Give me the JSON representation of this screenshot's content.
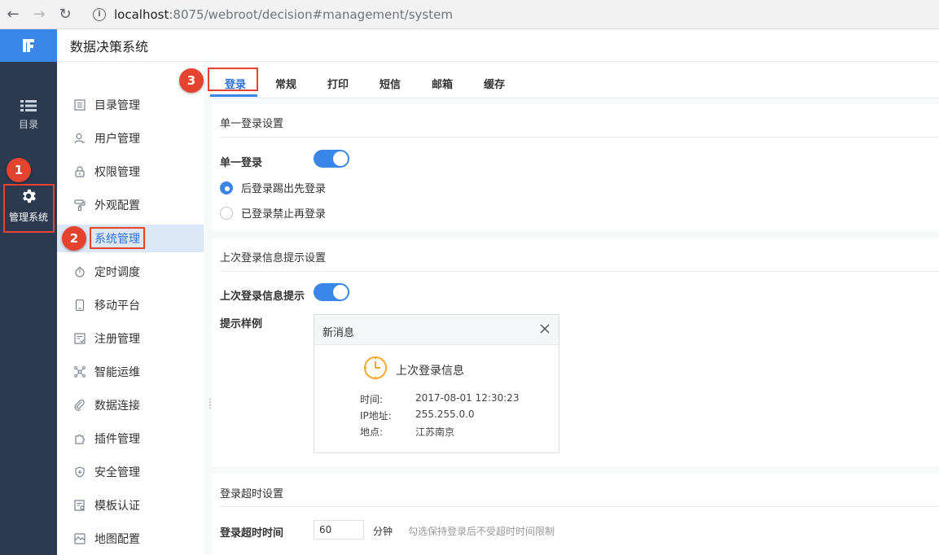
{
  "browser": {
    "url_host": "localhost",
    "url_path": ":8075/webroot/decision#management/system"
  },
  "app": {
    "title": "数据决策系统"
  },
  "rail": {
    "items": [
      {
        "label": "目录",
        "icon": "list-icon"
      },
      {
        "label": "管理系统",
        "icon": "gear-icon"
      }
    ]
  },
  "sidebar": {
    "items": [
      {
        "label": "目录管理",
        "icon": "list-doc-icon"
      },
      {
        "label": "用户管理",
        "icon": "user-icon"
      },
      {
        "label": "权限管理",
        "icon": "lock-icon"
      },
      {
        "label": "外观配置",
        "icon": "paint-roller-icon"
      },
      {
        "label": "系统管理",
        "icon": "gear-icon",
        "active": true
      },
      {
        "label": "定时调度",
        "icon": "stopwatch-icon"
      },
      {
        "label": "移动平台",
        "icon": "mobile-icon"
      },
      {
        "label": "注册管理",
        "icon": "register-icon"
      },
      {
        "label": "智能运维",
        "icon": "network-icon"
      },
      {
        "label": "数据连接",
        "icon": "link-icon"
      },
      {
        "label": "插件管理",
        "icon": "puzzle-icon"
      },
      {
        "label": "安全管理",
        "icon": "shield-icon"
      },
      {
        "label": "模板认证",
        "icon": "certificate-icon"
      },
      {
        "label": "地图配置",
        "icon": "map-icon"
      }
    ]
  },
  "tabs": [
    {
      "label": "登录",
      "active": true
    },
    {
      "label": "常规"
    },
    {
      "label": "打印"
    },
    {
      "label": "短信"
    },
    {
      "label": "邮箱"
    },
    {
      "label": "缓存"
    }
  ],
  "single_login": {
    "section_title": "单一登录设置",
    "toggle_label": "单一登录",
    "toggle_on": true,
    "options": [
      {
        "label": "后登录踢出先登录",
        "selected": true
      },
      {
        "label": "已登录禁止再登录",
        "selected": false
      }
    ]
  },
  "last_login": {
    "section_title": "上次登录信息提示设置",
    "toggle_label": "上次登录信息提示",
    "toggle_on": true,
    "sample_label": "提示样例",
    "notice": {
      "title": "新消息",
      "heading": "上次登录信息",
      "rows": [
        {
          "key": "时间:",
          "value": "2017-08-01 12:30:23"
        },
        {
          "key": "IP地址:",
          "value": "255.255.0.0"
        },
        {
          "key": "地点:",
          "value": "江苏南京"
        }
      ]
    }
  },
  "timeout": {
    "section_title": "登录超时设置",
    "field_label": "登录超时时间",
    "value": "60",
    "unit": "分钟",
    "hint": "勾选保持登录后不受超时时间限制"
  },
  "callouts": [
    "1",
    "2",
    "3"
  ],
  "colors": {
    "accent": "#3a86e8",
    "rail": "#2b3a4f",
    "callout": "#e5432f"
  }
}
